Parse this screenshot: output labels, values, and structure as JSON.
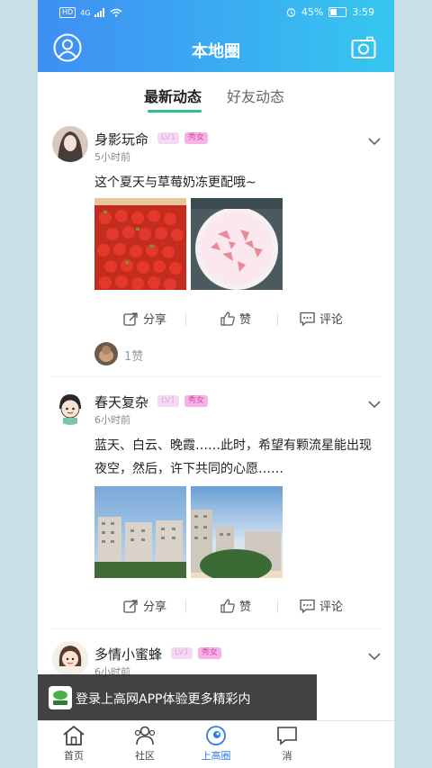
{
  "status_bar": {
    "hd": "HD",
    "network": "4G",
    "battery_pct": "45%",
    "time": "3:59"
  },
  "header": {
    "title": "本地圈"
  },
  "tabs": [
    {
      "label": "最新动态",
      "active": true
    },
    {
      "label": "好友动态",
      "active": false
    }
  ],
  "posts": [
    {
      "username": "身影玩命",
      "level": "LV1",
      "gender_tag": "秀女",
      "time": "5小时前",
      "content": "这个夏天与草莓奶冻更配哦~",
      "actions": {
        "share": "分享",
        "like": "赞",
        "comment": "评论"
      },
      "likes": "1赞"
    },
    {
      "username": "春天复杂",
      "level": "LV1",
      "gender_tag": "秀女",
      "time": "6小时前",
      "content": "蓝天、白云、晚霞……此时，希望有颗流星能出现夜空，然后，许下共同的心愿……",
      "actions": {
        "share": "分享",
        "like": "赞",
        "comment": "评论"
      }
    },
    {
      "username": "多情小蜜蜂",
      "level": "LV1",
      "gender_tag": "秀女",
      "time": "6小时前"
    }
  ],
  "login_banner": {
    "text": "登录上高网APP体验更多精彩内"
  },
  "bottom_nav": [
    {
      "label": "首页",
      "icon": "home-icon"
    },
    {
      "label": "社区",
      "icon": "community-icon"
    },
    {
      "label": "上高圈",
      "icon": "circle-icon",
      "active": true
    },
    {
      "label": "消",
      "icon": "message-icon"
    }
  ],
  "colors": {
    "header_start": "#3f8ef3",
    "header_end": "#35c7f0",
    "accent_green": "#2dbf8f",
    "nav_active": "#2f7fe3"
  }
}
